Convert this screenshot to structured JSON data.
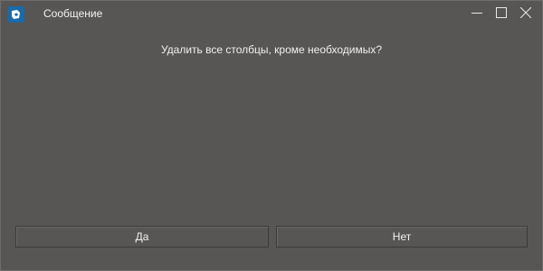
{
  "window": {
    "title": "Сообщение",
    "icon": "app-logo-icon",
    "controls": [
      "minimize-icon",
      "maximize-icon",
      "close-icon"
    ]
  },
  "dialog": {
    "message": "Удалить все столбцы, кроме необходимых?",
    "buttons": {
      "yes_label": "Да",
      "no_label": "Нет"
    }
  },
  "colors": {
    "background": "#575654",
    "text": "#f2f2f2",
    "accent": "#1a6aa8"
  }
}
